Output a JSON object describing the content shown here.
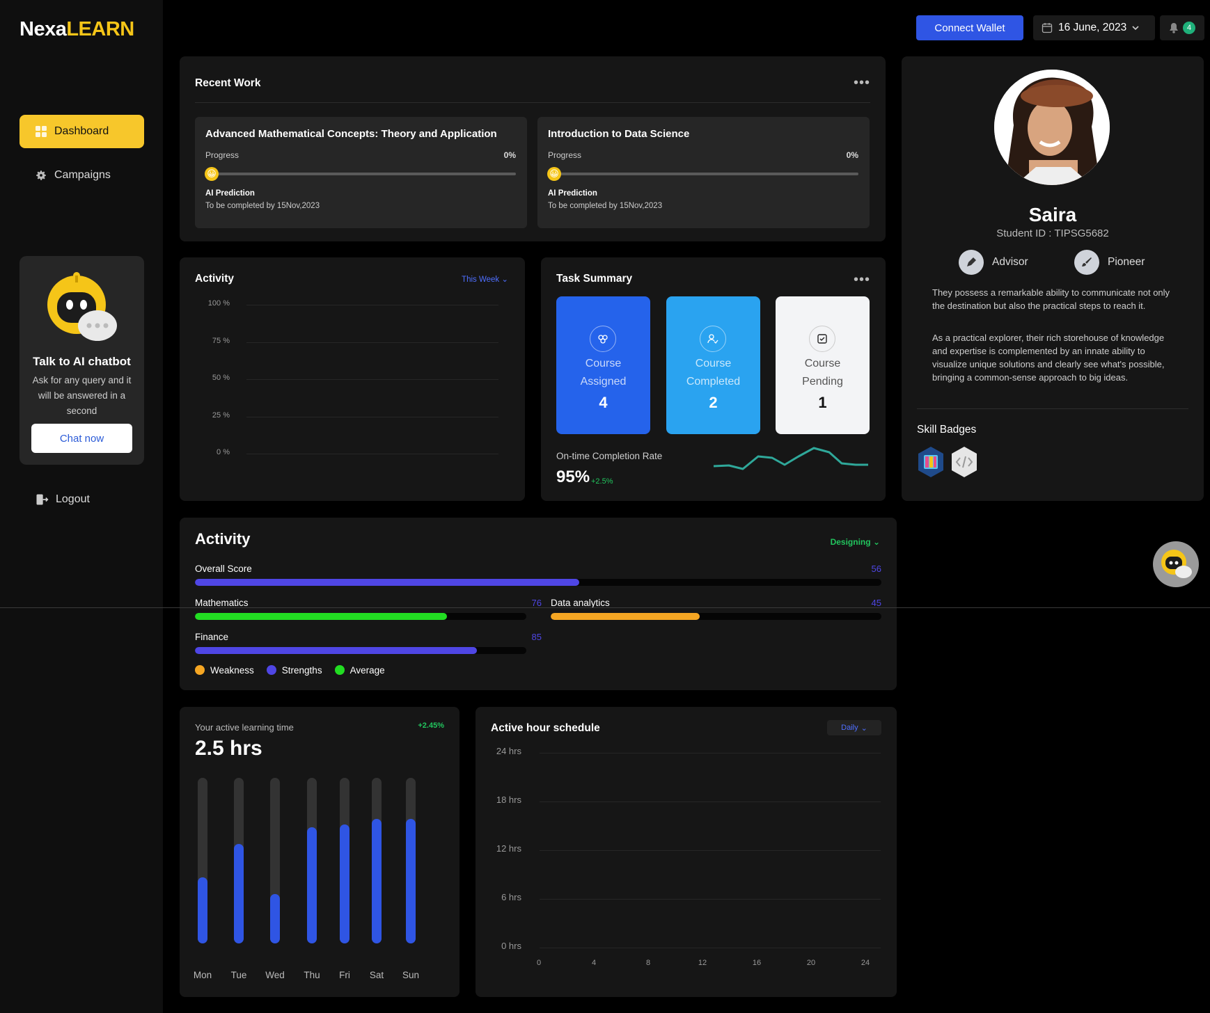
{
  "brand": {
    "part1": "Nexa",
    "part2": "LEARN"
  },
  "sidebar": {
    "items": [
      {
        "label": "Dashboard",
        "icon": "grid-icon",
        "active": true
      },
      {
        "label": "Campaigns",
        "icon": "gear-icon",
        "active": false
      }
    ],
    "logout": "Logout",
    "chatbot": {
      "title": "Talk to AI chatbot",
      "description": "Ask for any query and it will be answered in a second",
      "button": "Chat now"
    }
  },
  "topbar": {
    "connect_wallet": "Connect Wallet",
    "date": "16 June, 2023",
    "notifications": "4"
  },
  "recent_work": {
    "title": "Recent Work",
    "cards": [
      {
        "title": "Advanced Mathematical Concepts: Theory and Application",
        "progress_label": "Progress",
        "progress": "0%",
        "ai_label": "AI Prediction",
        "ai_text": "To be completed by 15Nov,2023"
      },
      {
        "title": "Introduction to Data Science",
        "progress_label": "Progress",
        "progress": "0%",
        "ai_label": "AI Prediction",
        "ai_text": "To be completed by 15Nov,2023"
      }
    ]
  },
  "activity_chart": {
    "title": "Activity",
    "range": "This Week",
    "y_ticks": [
      "100 %",
      "75 %",
      "50 %",
      "25 %",
      "0 %"
    ]
  },
  "task_summary": {
    "title": "Task Summary",
    "cards": [
      {
        "line1": "Course",
        "line2": "Assigned",
        "value": "4"
      },
      {
        "line1": "Course",
        "line2": "Completed",
        "value": "2"
      },
      {
        "line1": "Course",
        "line2": "Pending",
        "value": "1"
      }
    ],
    "ontime_label": "On-time Completion Rate",
    "ontime_value": "95%",
    "ontime_delta": "+2.5%",
    "sparkline_color": "#2fa89a"
  },
  "profile": {
    "name": "Saira",
    "student_id": "Student ID : TIPSG5682",
    "roles": [
      "Advisor",
      "Pioneer"
    ],
    "bio": [
      "They possess a remarkable ability to communicate not only the destination but also the practical steps to reach it.",
      "As a practical explorer, their rich storehouse of knowledge and expertise is complemented by an innate ability to visualize unique solutions and clearly see what's possible, bringing a common-sense approach to big ideas."
    ],
    "skill_title": "Skill Badges"
  },
  "scores": {
    "title": "Activity",
    "filter": "Designing",
    "items": [
      {
        "label": "Overall Score",
        "value": 56,
        "display": "56",
        "color": "#4f46e5"
      },
      {
        "label": "Mathematics",
        "value": 76,
        "display": "76",
        "color": "#22dd22"
      },
      {
        "label": "Data analytics",
        "value": 45,
        "display": "45",
        "color": "#f5a623"
      },
      {
        "label": "Finance",
        "value": 85,
        "display": "85",
        "color": "#4f46e5"
      }
    ],
    "legend": [
      {
        "label": "Weakness",
        "color": "#f5a623"
      },
      {
        "label": "Strengths",
        "color": "#4f46e5"
      },
      {
        "label": "Average",
        "color": "#22dd22"
      }
    ]
  },
  "learning_time": {
    "label": "Your active learning time",
    "delta": "+2.45%",
    "value": "2.5 hrs",
    "days": [
      {
        "day": "Mon",
        "fraction": 0.4
      },
      {
        "day": "Tue",
        "fraction": 0.6
      },
      {
        "day": "Wed",
        "fraction": 0.3
      },
      {
        "day": "Thu",
        "fraction": 0.7
      },
      {
        "day": "Fri",
        "fraction": 0.72
      },
      {
        "day": "Sat",
        "fraction": 0.75
      },
      {
        "day": "Sun",
        "fraction": 0.75
      }
    ]
  },
  "active_hours": {
    "title": "Active hour schedule",
    "filter": "Daily",
    "y_ticks": [
      "24 hrs",
      "18 hrs",
      "12 hrs",
      "6 hrs",
      "0 hrs"
    ],
    "x_ticks": [
      "0",
      "4",
      "8",
      "12",
      "16",
      "20",
      "24"
    ]
  }
}
